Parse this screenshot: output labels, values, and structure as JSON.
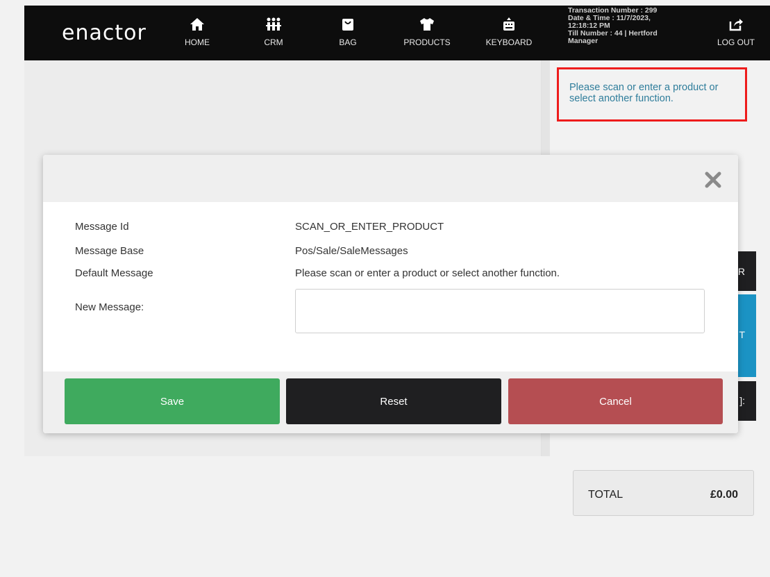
{
  "header": {
    "logo": "enactor",
    "nav": [
      {
        "label": "HOME",
        "icon": "home-icon"
      },
      {
        "label": "CRM",
        "icon": "people-icon"
      },
      {
        "label": "BAG",
        "icon": "bag-icon"
      },
      {
        "label": "PRODUCTS",
        "icon": "tshirt-icon"
      },
      {
        "label": "KEYBOARD",
        "icon": "keyboard-icon"
      }
    ],
    "transaction": {
      "line1": "Transaction Number : 299",
      "line2": "Date & Time : 11/7/2023,",
      "line3": "12:18:12 PM",
      "line4": "Till Number : 44  |  Hertford",
      "line5": "Manager"
    },
    "logout": {
      "label": "LOG OUT",
      "icon": "logout-icon"
    }
  },
  "prompt": {
    "text": "Please scan or enter a product or select another function."
  },
  "side_buttons": {
    "b1": "R",
    "b2": "T",
    "b3": "]:"
  },
  "total": {
    "label": "TOTAL",
    "value": "£0.00"
  },
  "modal": {
    "close_icon": "close-icon",
    "rows": [
      {
        "label": "Message Id",
        "value": "SCAN_OR_ENTER_PRODUCT"
      },
      {
        "label": "Message Base",
        "value": "Pos/Sale/SaleMessages"
      },
      {
        "label": "Default Message",
        "value": "Please scan or enter a product or select another function."
      }
    ],
    "new_message_label": "New Message:",
    "new_message_value": "",
    "buttons": {
      "save": "Save",
      "reset": "Reset",
      "cancel": "Cancel"
    }
  },
  "colors": {
    "header_bg": "#0d0d0d",
    "prompt_text": "#2f7d9b",
    "prompt_border": "#ee1c1c",
    "save": "#3faa5e",
    "reset": "#1f1f21",
    "cancel": "#b54e52",
    "side_teal": "#1b93c4"
  }
}
